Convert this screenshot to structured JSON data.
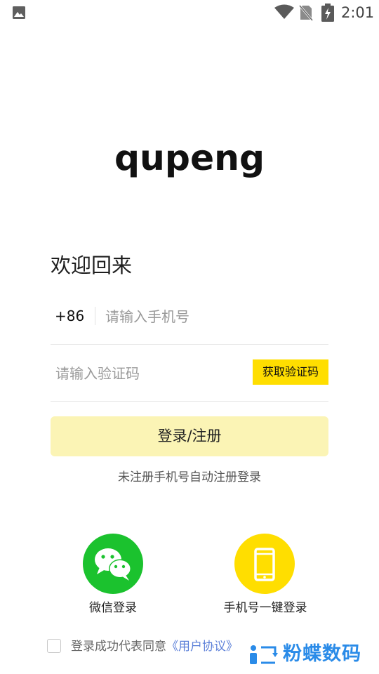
{
  "status_bar": {
    "time": "2:01",
    "icons": [
      "image-icon",
      "wifi-icon",
      "no-sim-icon",
      "battery-charging-icon"
    ]
  },
  "logo": {
    "text": "qupeng"
  },
  "welcome_title": "欢迎回来",
  "phone": {
    "country_code": "+86",
    "placeholder": "请输入手机号"
  },
  "code": {
    "placeholder": "请输入验证码",
    "get_code_label": "获取验证码"
  },
  "login_button": "登录/注册",
  "hint": "未注册手机号自动注册登录",
  "social": {
    "wechat_label": "微信登录",
    "mobile_label": "手机号一键登录"
  },
  "agreement": {
    "text": "登录成功代表同意",
    "link": "《用户协议》"
  },
  "watermark": {
    "text": "粉蝶数码"
  },
  "colors": {
    "accent": "#ffde00",
    "login_button_bg": "#fbf4b5",
    "wechat_green": "#1bc22e",
    "link": "#5b7fd8",
    "watermark_blue": "#2a8be8"
  }
}
